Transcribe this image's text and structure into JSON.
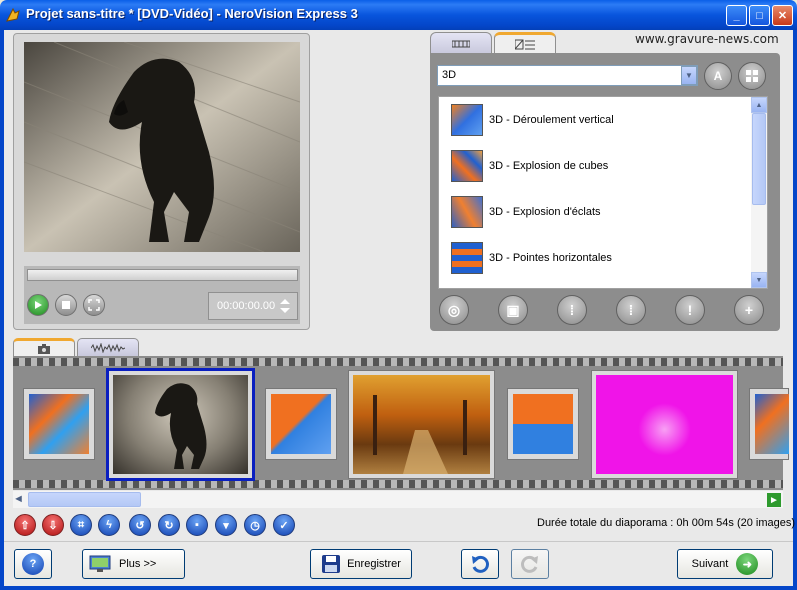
{
  "window": {
    "title": "Projet sans-titre * [DVD-Vidéo] - NeroVision Express 3",
    "minimize": "_",
    "maximize": "□",
    "close": "✕"
  },
  "watermark": "www.gravure-news.com",
  "preview": {
    "time": "00:00:00.00"
  },
  "effects": {
    "category": "3D",
    "items": [
      {
        "label": "3D - Déroulement vertical"
      },
      {
        "label": "3D - Explosion de cubes"
      },
      {
        "label": "3D - Explosion d'éclats"
      },
      {
        "label": "3D - Pointes horizontales"
      }
    ]
  },
  "status": {
    "duration": "Durée totale du diaporama : 0h 00m 54s (20 images)"
  },
  "buttons": {
    "help": "?",
    "more": "Plus >>",
    "save": "Enregistrer",
    "next": "Suivant"
  },
  "colors": {
    "titlebar": "#0A5FE8",
    "selected_clip_border": "#0A1FC0",
    "magenta_clip": "#F014E8"
  }
}
